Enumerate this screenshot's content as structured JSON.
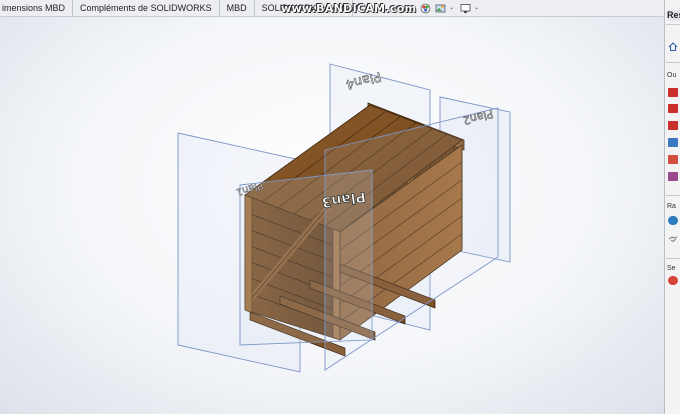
{
  "tabs": [
    {
      "label": "imensions MBD"
    },
    {
      "label": "Compléments de SOLIDWORKS"
    },
    {
      "label": "MBD"
    },
    {
      "label": "SOLIDWORKS CAM"
    }
  ],
  "watermark": "www.BANDICAM.com",
  "task_pane": {
    "title": "Res",
    "sections": [
      {
        "label": "Ou"
      },
      {
        "label": "Ra"
      },
      {
        "label": "Se"
      }
    ]
  },
  "planes": {
    "top": "Plan4",
    "right": "Plan2",
    "front": "Plan3",
    "left": "Plan1"
  },
  "colors": {
    "plane_stroke": "#7d95c8",
    "wood_light": "#8a5a2b",
    "wood_dark": "#5a3715",
    "toolbar_bg": "#eceef1"
  }
}
